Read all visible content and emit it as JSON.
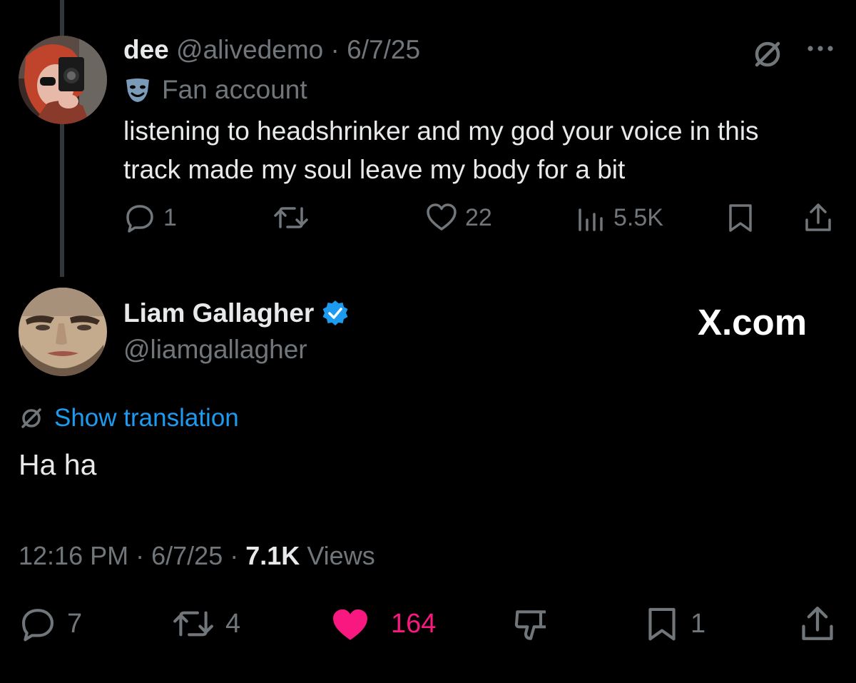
{
  "parent_tweet": {
    "display_name": "dee",
    "handle": "@alivedemo",
    "separator": "·",
    "date": "6/7/25",
    "label_icon": "theater-masks-icon",
    "label": "Fan account",
    "text": "listening to headshrinker and my god your voice in this track made my soul leave my body for a bit",
    "actions": {
      "replies": "1",
      "reposts": "",
      "likes": "22",
      "views": "5.5K"
    }
  },
  "reply_tweet": {
    "display_name": "Liam Gallagher",
    "verified": true,
    "handle": "@liamgallagher",
    "show_translation": "Show translation",
    "text": "Ha ha",
    "time": "12:16 PM",
    "separator": "·",
    "date": "6/7/25",
    "views_count": "7.1K",
    "views_label": "Views",
    "actions": {
      "replies": "7",
      "reposts": "4",
      "likes": "164",
      "bookmarks": "1"
    }
  },
  "watermark": "X.com",
  "colors": {
    "background": "#000000",
    "text": "#e7e9ea",
    "muted": "#71767b",
    "accent": "#1d9bf0",
    "like": "#f91880",
    "thread_line": "#333639"
  }
}
